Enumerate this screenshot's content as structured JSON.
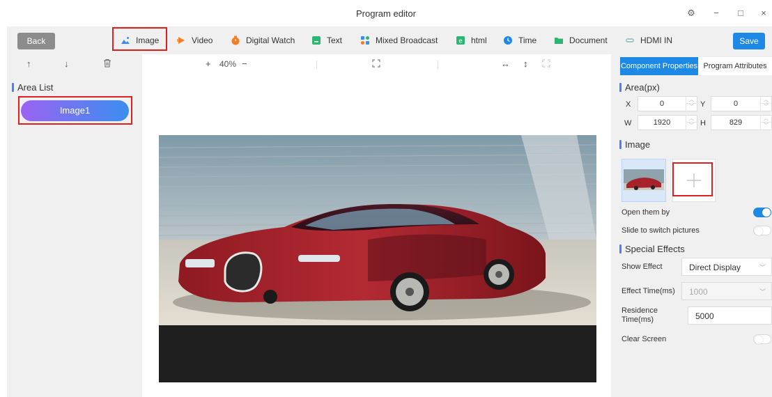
{
  "window": {
    "title": "Program editor",
    "settings_icon": "⚙",
    "minimize_icon": "−",
    "maximize_icon": "□",
    "close_icon": "×"
  },
  "toolbar": {
    "back_label": "Back",
    "save_label": "Save",
    "items": [
      {
        "label": "Image",
        "icon": "image-icon",
        "color": "#3a8eef"
      },
      {
        "label": "Video",
        "icon": "video-icon",
        "color": "#f57c22"
      },
      {
        "label": "Digital Watch",
        "icon": "watch-icon",
        "color": "#f57c22"
      },
      {
        "label": "Text",
        "icon": "text-icon",
        "color": "#2bb673"
      },
      {
        "label": "Mixed Broadcast",
        "icon": "mixed-broadcast-icon",
        "color": "#3a8eef"
      },
      {
        "label": "html",
        "icon": "html-icon",
        "color": "#2bb673"
      },
      {
        "label": "Time",
        "icon": "clock-icon",
        "color": "#1e88e5"
      },
      {
        "label": "Document",
        "icon": "document-icon",
        "color": "#2bb673"
      },
      {
        "label": "HDMI IN",
        "icon": "hdmi-icon",
        "color": "#9bc9c4"
      }
    ]
  },
  "left": {
    "up_icon": "↑",
    "down_icon": "↓",
    "delete_icon": "🗑",
    "area_list_title": "Area List",
    "areas": [
      {
        "label": "Image1"
      }
    ]
  },
  "center": {
    "zoom_in": "+",
    "zoom_level": "40%",
    "zoom_out": "−",
    "fit_icon": "⛶",
    "h_stretch_icon": "↔",
    "v_stretch_icon": "↕",
    "fullscreen_icon": "⛶"
  },
  "right": {
    "tabs": [
      "Component Properties",
      "Program Attributes"
    ],
    "area_title": "Area(px)",
    "x_label": "X",
    "x_value": "0",
    "y_label": "Y",
    "y_value": "0",
    "w_label": "W",
    "w_value": "1920",
    "h_label": "H",
    "h_value": "829",
    "image_title": "Image",
    "add_icon": "+",
    "open_them_by": "Open them by",
    "open_them_by_on": true,
    "slide_to_switch": "Slide to switch pictures",
    "slide_to_switch_on": false,
    "special_effects_title": "Special Effects",
    "show_effect_label": "Show Effect",
    "show_effect_value": "Direct Display",
    "effect_time_label": "Effect Time(ms)",
    "effect_time_value": "1000",
    "residence_time_label_1": "Residence",
    "residence_time_label_2": "Time(ms)",
    "residence_time_value": "5000",
    "clear_screen_label": "Clear Screen",
    "clear_screen_on": false
  }
}
